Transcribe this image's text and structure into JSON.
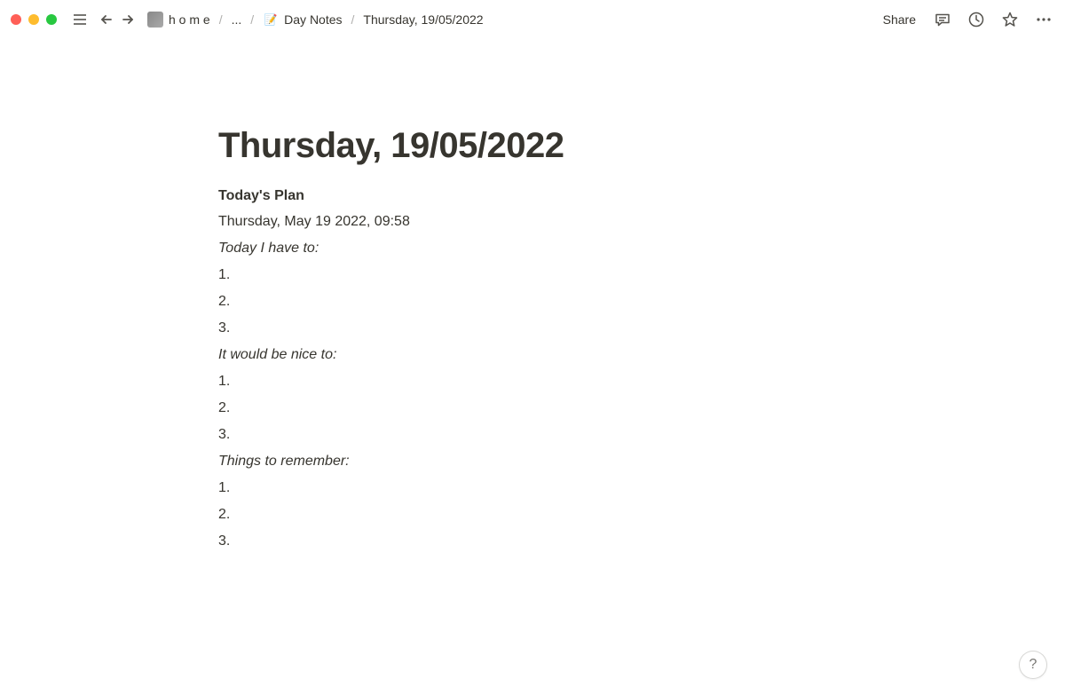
{
  "topbar": {
    "breadcrumbs": {
      "home_label": "h o m e",
      "ellipsis": "...",
      "daynotes_label": "Day Notes",
      "current_label": "Thursday, 19/05/2022"
    },
    "share_label": "Share"
  },
  "page": {
    "title": "Thursday, 19/05/2022",
    "section_heading": "Today's Plan",
    "timestamp": "Thursday, May 19 2022, 09:58",
    "block1_label": "Today I have to:",
    "block1_items": {
      "i1": "1.",
      "i2": "2.",
      "i3": "3."
    },
    "block2_label": "It would be nice to:",
    "block2_items": {
      "i1": "1.",
      "i2": "2.",
      "i3": "3."
    },
    "block3_label": "Things to remember:",
    "block3_items": {
      "i1": "1.",
      "i2": "2.",
      "i3": "3."
    }
  },
  "help": {
    "label": "?"
  }
}
